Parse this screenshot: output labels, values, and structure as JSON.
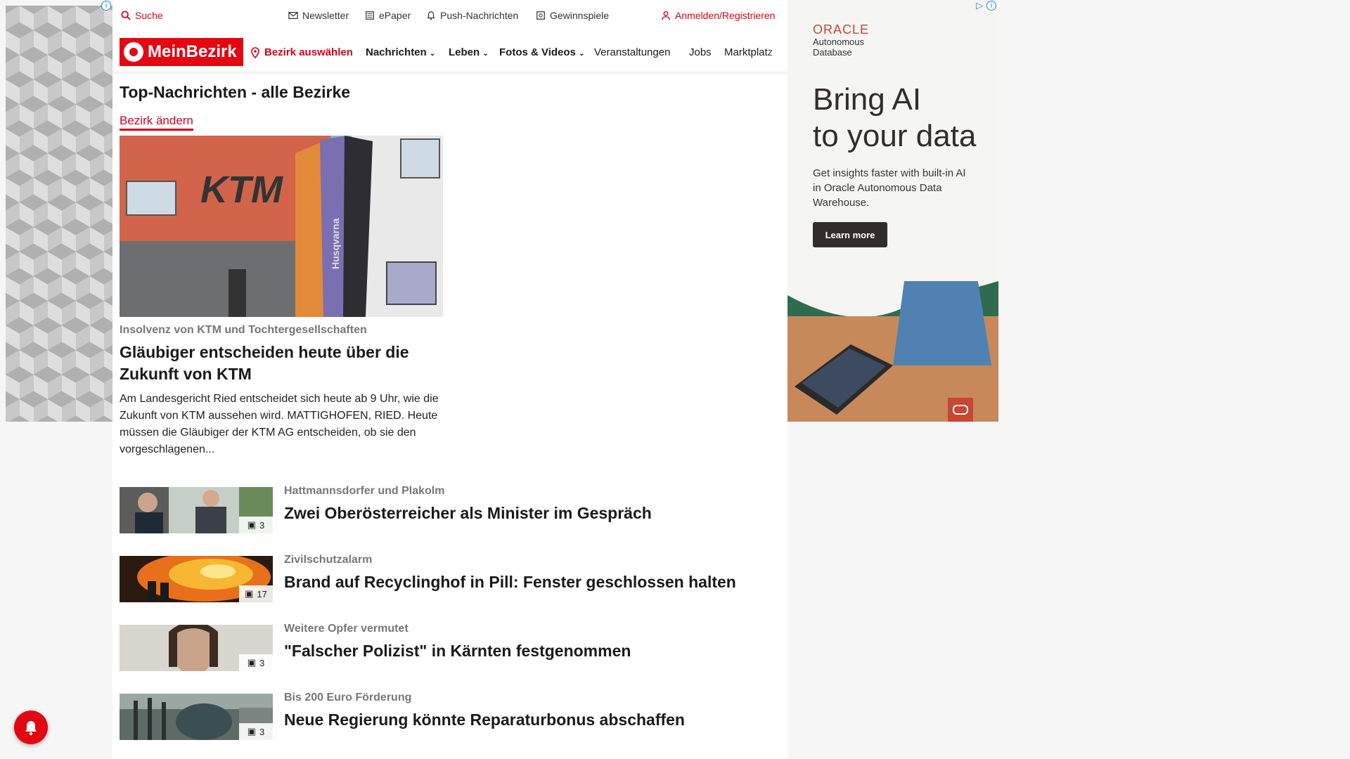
{
  "topbar": {
    "search": "Suche",
    "newsletter": "Newsletter",
    "epaper": "ePaper",
    "push": "Push-Nachrichten",
    "gewinnspiele": "Gewinnspiele",
    "login": "Anmelden/Registrieren"
  },
  "nav": {
    "logo": "MeinBezirk",
    "bezirk": "Bezirk auswählen",
    "items": [
      "Nachrichten",
      "Leben",
      "Fotos & Videos",
      "Veranstaltungen",
      "Jobs",
      "Marktplatz"
    ]
  },
  "page": {
    "title": "Top-Nachrichten - alle Bezirke",
    "change_link": "Bezirk ändern"
  },
  "hero": {
    "kicker": "Insolvenz von KTM und Tochtergesellschaften",
    "title": "Gläubiger entscheiden heute über die Zukunft von KTM",
    "teaser": "Am Landesgericht Ried entscheidet sich heute ab 9 Uhr, wie die Zukunft von KTM aussehen wird. MATTIGHOFEN, RIED. Heute müssen die Gläubiger der KTM AG entscheiden, ob sie den vorgeschlagenen...",
    "image_sign": "KTM",
    "flag_text": "Husqvarna"
  },
  "articles": [
    {
      "kicker": "Hattmannsdorfer und Plakolm",
      "title": "Zwei Oberösterreicher als Minister im Gespräch",
      "count": "3"
    },
    {
      "kicker": "Zivilschutzalarm",
      "title": "Brand auf Recyclinghof in Pill: Fenster geschlossen halten",
      "count": "17"
    },
    {
      "kicker": "Weitere Opfer vermutet",
      "title": "\"Falscher Polizist\" in Kärnten festgenommen",
      "count": "3"
    },
    {
      "kicker": "Bis 200 Euro Förderung",
      "title": "Neue Regierung könnte Reparaturbonus abschaffen",
      "count": "3"
    }
  ],
  "ad": {
    "brand": "ORACLE",
    "brand_sub": "Autonomous Database",
    "headline_1": "Bring AI",
    "headline_2": "to your data",
    "description": "Get insights faster with built-in AI in Oracle Autonomous Data Warehouse.",
    "cta": "Learn more"
  },
  "colors": {
    "brand_red": "#e30613",
    "link_red": "#d0021b",
    "oracle_red": "#c74634"
  }
}
